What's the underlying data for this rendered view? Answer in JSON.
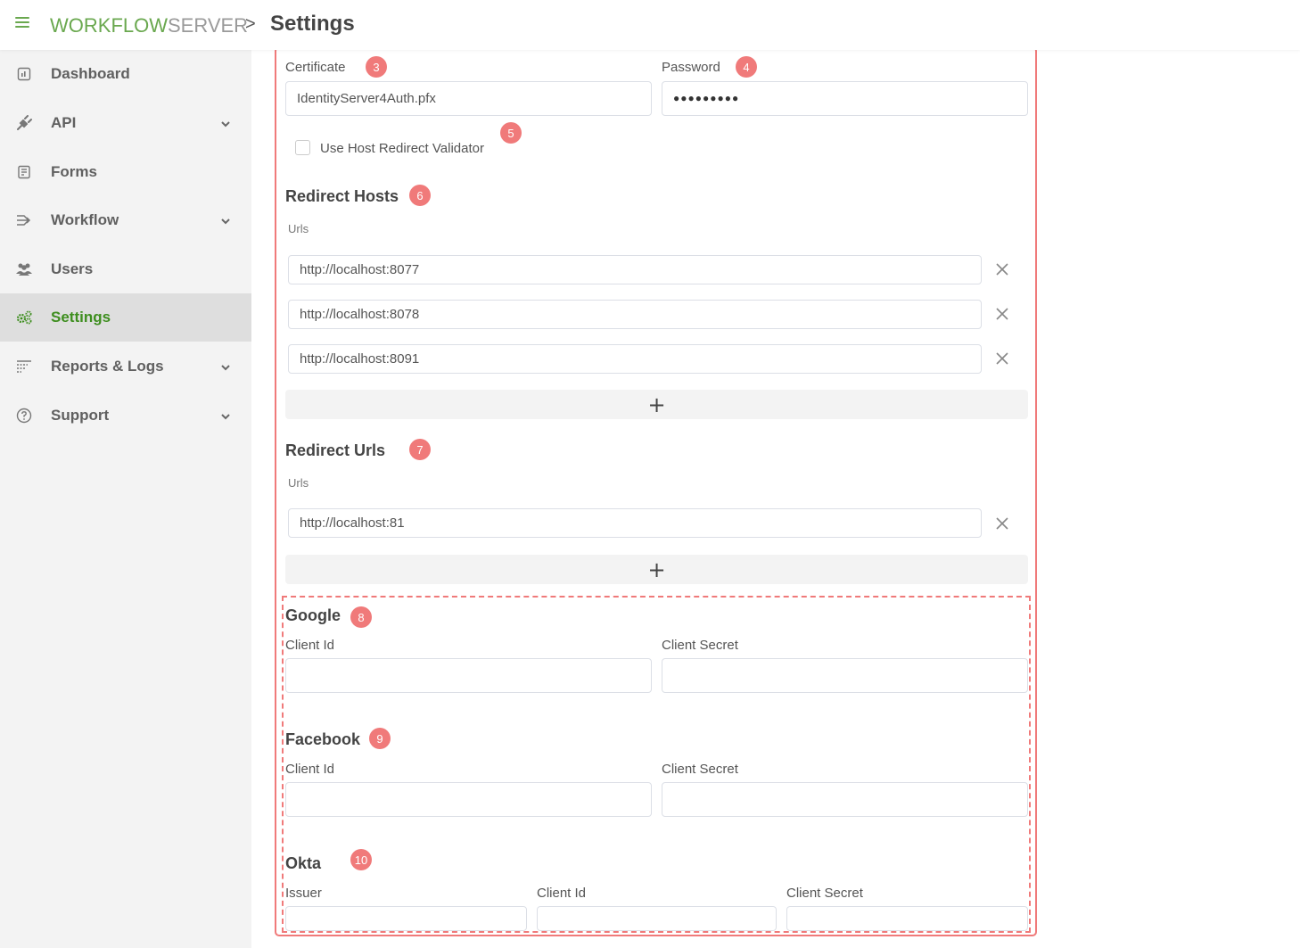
{
  "header": {
    "logo_part1": "WORKFLOW",
    "logo_part2": "SERVER",
    "separator": ">",
    "page_title": "Settings"
  },
  "sidebar": {
    "items": [
      {
        "label": "Dashboard",
        "icon": "dashboard-icon",
        "has_chevron": false,
        "active": false
      },
      {
        "label": "API",
        "icon": "plug-icon",
        "has_chevron": true,
        "active": false
      },
      {
        "label": "Forms",
        "icon": "form-icon",
        "has_chevron": false,
        "active": false
      },
      {
        "label": "Workflow",
        "icon": "workflow-icon",
        "has_chevron": true,
        "active": false
      },
      {
        "label": "Users",
        "icon": "users-icon",
        "has_chevron": false,
        "active": false
      },
      {
        "label": "Settings",
        "icon": "gears-icon",
        "has_chevron": false,
        "active": true
      },
      {
        "label": "Reports & Logs",
        "icon": "reports-icon",
        "has_chevron": true,
        "active": false
      },
      {
        "label": "Support",
        "icon": "help-icon",
        "has_chevron": true,
        "active": false
      }
    ]
  },
  "certificate": {
    "label": "Certificate",
    "badge": "3",
    "value": "IdentityServer4Auth.pfx"
  },
  "password": {
    "label": "Password",
    "badge": "4",
    "value": "●●●●●●●●●"
  },
  "host_validator": {
    "label": "Use Host Redirect Validator",
    "badge": "5",
    "checked": false
  },
  "redirect_hosts": {
    "title": "Redirect Hosts",
    "badge": "6",
    "sub_label": "Urls",
    "urls": [
      "http://localhost:8077",
      "http://localhost:8078",
      "http://localhost:8091"
    ],
    "add_label": "+"
  },
  "redirect_urls": {
    "title": "Redirect Urls",
    "badge": "7",
    "sub_label": "Urls",
    "urls": [
      "http://localhost:81"
    ],
    "add_label": "+"
  },
  "google": {
    "title": "Google",
    "badge": "8",
    "client_id_label": "Client Id",
    "client_id_value": "",
    "client_secret_label": "Client Secret",
    "client_secret_value": ""
  },
  "facebook": {
    "title": "Facebook",
    "badge": "9",
    "client_id_label": "Client Id",
    "client_id_value": "",
    "client_secret_label": "Client Secret",
    "client_secret_value": ""
  },
  "okta": {
    "title": "Okta",
    "badge": "10",
    "issuer_label": "Issuer",
    "issuer_value": "",
    "client_id_label": "Client Id",
    "client_id_value": "",
    "client_secret_label": "Client Secret",
    "client_secret_value": ""
  },
  "colors": {
    "accent_green": "#6aa84f",
    "active_green": "#3e8e1f",
    "annotation_red": "#f07a7a"
  }
}
